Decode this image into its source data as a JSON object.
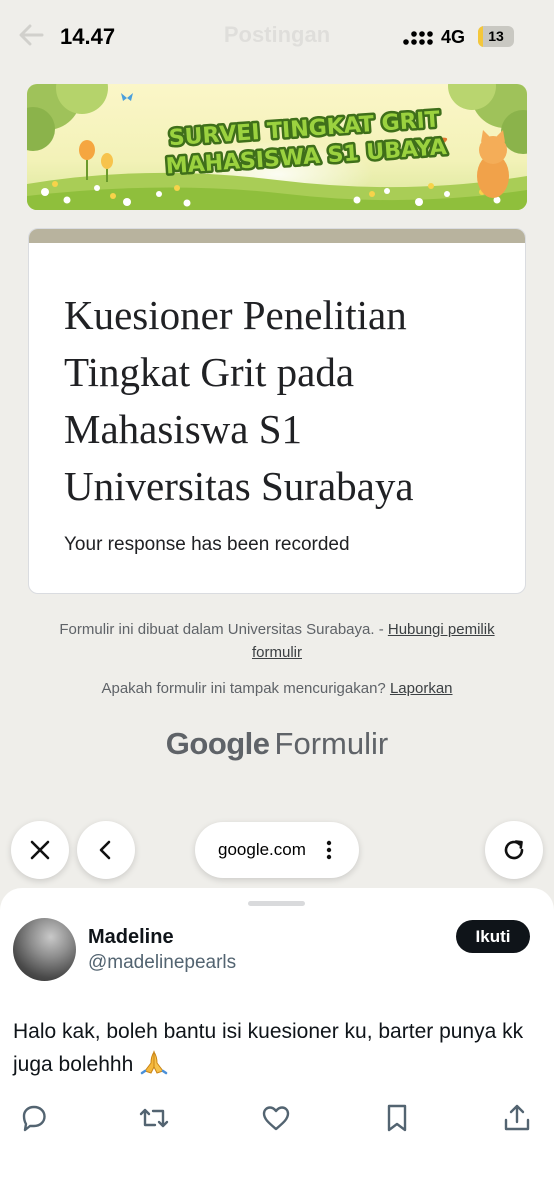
{
  "status_bar": {
    "time": "14.47",
    "network": "4G",
    "battery_level": "13",
    "battery_fraction": 0.13
  },
  "page_heading": "Postingan",
  "banner": {
    "line1": "SURVEI TINGKAT GRIT",
    "line2": "MAHASISWA S1 UBAYA"
  },
  "form": {
    "title": "Kuesioner Penelitian Tingkat Grit pada Mahasiswa S1 Universitas Surabaya",
    "confirmation": "Your response has been recorded"
  },
  "footer": {
    "created_in": "Formulir ini dibuat dalam Universitas Surabaya. - ",
    "contact_owner_link": "Hubungi pemilik formulir",
    "suspicious_question": "Apakah formulir ini tampak mencurigakan? ",
    "report_link": "Laporkan",
    "brand": "Google",
    "product": "Formulir"
  },
  "browser_bar": {
    "url": "google.com"
  },
  "tweet": {
    "display_name": "Madeline",
    "handle": "@madelinepearls",
    "follow_label": "Ikuti",
    "text": "Halo kak, boleh bantu isi kuesioner ku, barter punya kk juga bolehhh ",
    "emoji": "🙏"
  },
  "icons": {
    "actions": [
      "reply-icon",
      "retweet-icon",
      "like-icon",
      "bookmark-icon",
      "share-icon"
    ],
    "browser": [
      "close-icon",
      "back-icon",
      "more-vertical-icon",
      "reload-icon"
    ]
  },
  "colors": {
    "page_background": "#efeeea",
    "card_accent": "#b8b39e",
    "banner_text": "#8fc93a",
    "follow_button": "#0f1419"
  }
}
